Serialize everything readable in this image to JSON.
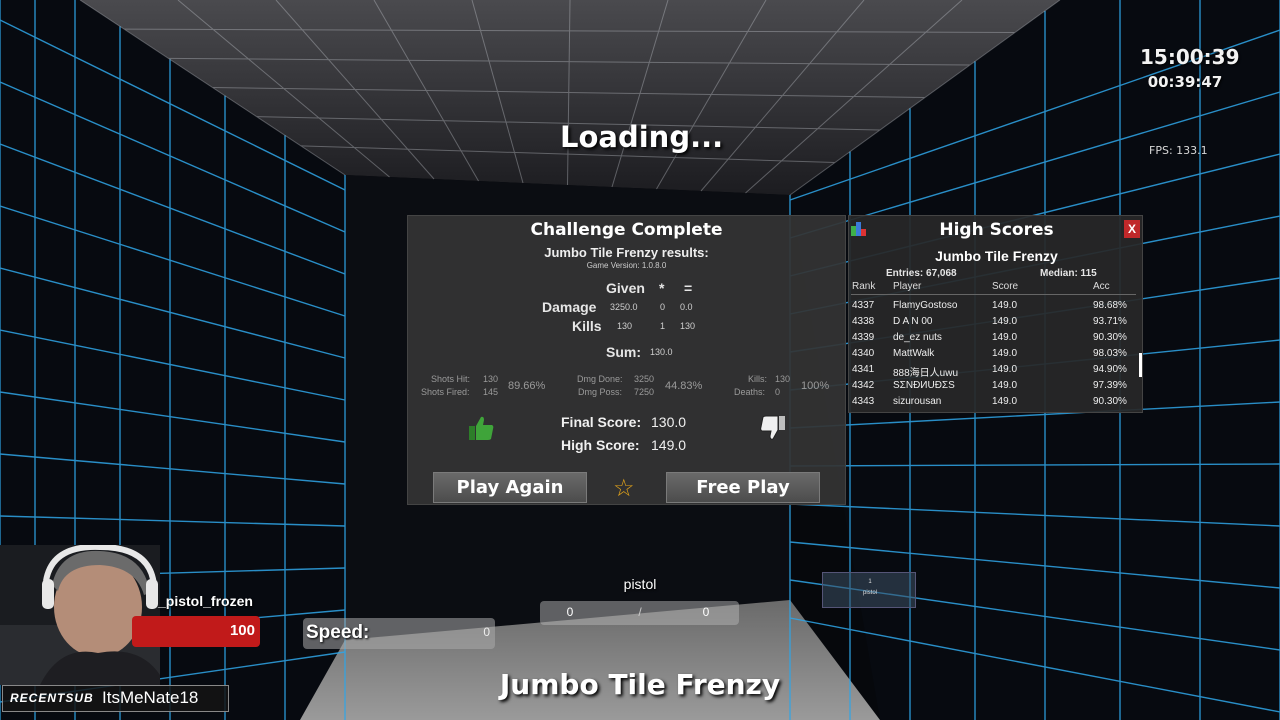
{
  "hud": {
    "clock_time": "15:00:39",
    "clock_elapsed": "00:39:47",
    "fps": "FPS: 133.1",
    "loading": "Loading...",
    "player_name": "_pistol_frozen",
    "health": "100",
    "speed_label": "Speed:",
    "speed_value": "0",
    "weapon": "pistol",
    "ammo_current": "0",
    "ammo_sep": "/",
    "ammo_reserve": "0",
    "slot_number": "1",
    "slot_weapon": "pistol",
    "scenario": "Jumbo Tile Frenzy",
    "sub_tag": "RECENTSUB",
    "sub_user": "ItsMeNate18"
  },
  "challenge": {
    "title": "Challenge Complete",
    "results_title": "Jumbo Tile Frenzy results:",
    "version": "Game Version: 1.0.8.0",
    "col_given": "Given",
    "col_mult": "*",
    "col_eq": "=",
    "damage_label": "Damage",
    "damage_given": "3250.0",
    "damage_mult": "0",
    "damage_result": "0.0",
    "kills_label": "Kills",
    "kills_given": "130",
    "kills_mult": "1",
    "kills_result": "130",
    "sum_label": "Sum:",
    "sum_value": "130.0",
    "shots_hit_label": "Shots Hit:",
    "shots_hit": "130",
    "shots_fired_label": "Shots Fired:",
    "shots_fired": "145",
    "shot_acc": "89.66%",
    "dmg_done_label": "Dmg Done:",
    "dmg_done": "3250",
    "dmg_poss_label": "Dmg Poss:",
    "dmg_poss": "7250",
    "dmg_eff": "44.83%",
    "kills_stat_label": "Kills:",
    "kills_stat": "130",
    "deaths_label": "Deaths:",
    "deaths": "0",
    "kd_pct": "100%",
    "final_label": "Final Score:",
    "final_value": "130.0",
    "high_label": "High Score:",
    "high_value": "149.0",
    "play_again": "Play Again",
    "free_play": "Free Play",
    "colors": {
      "thumb_up": "#3fa43a",
      "thumb_down": "#f0f0f0",
      "star": "#e0a21a"
    }
  },
  "highscores": {
    "title": "High Scores",
    "close": "X",
    "board": "Jumbo Tile Frenzy",
    "entries": "Entries: 67,068",
    "median": "Median: 115",
    "headers": [
      "Rank",
      "Player",
      "Score",
      "Acc"
    ],
    "rows": [
      {
        "rank": "4337",
        "player": "FlamyGostoso",
        "score": "149.0",
        "acc": "98.68%"
      },
      {
        "rank": "4338",
        "player": "D A N 00",
        "score": "149.0",
        "acc": "93.71%"
      },
      {
        "rank": "4339",
        "player": "de_ez nuts",
        "score": "149.0",
        "acc": "90.30%"
      },
      {
        "rank": "4340",
        "player": "MattWalk",
        "score": "149.0",
        "acc": "98.03%"
      },
      {
        "rank": "4341",
        "player": "888海日人uwu",
        "score": "149.0",
        "acc": "94.90%"
      },
      {
        "rank": "4342",
        "player": "SΣNÐИUÐΣS",
        "score": "149.0",
        "acc": "97.39%"
      },
      {
        "rank": "4343",
        "player": "sizurousan",
        "score": "149.0",
        "acc": "90.30%"
      }
    ]
  }
}
